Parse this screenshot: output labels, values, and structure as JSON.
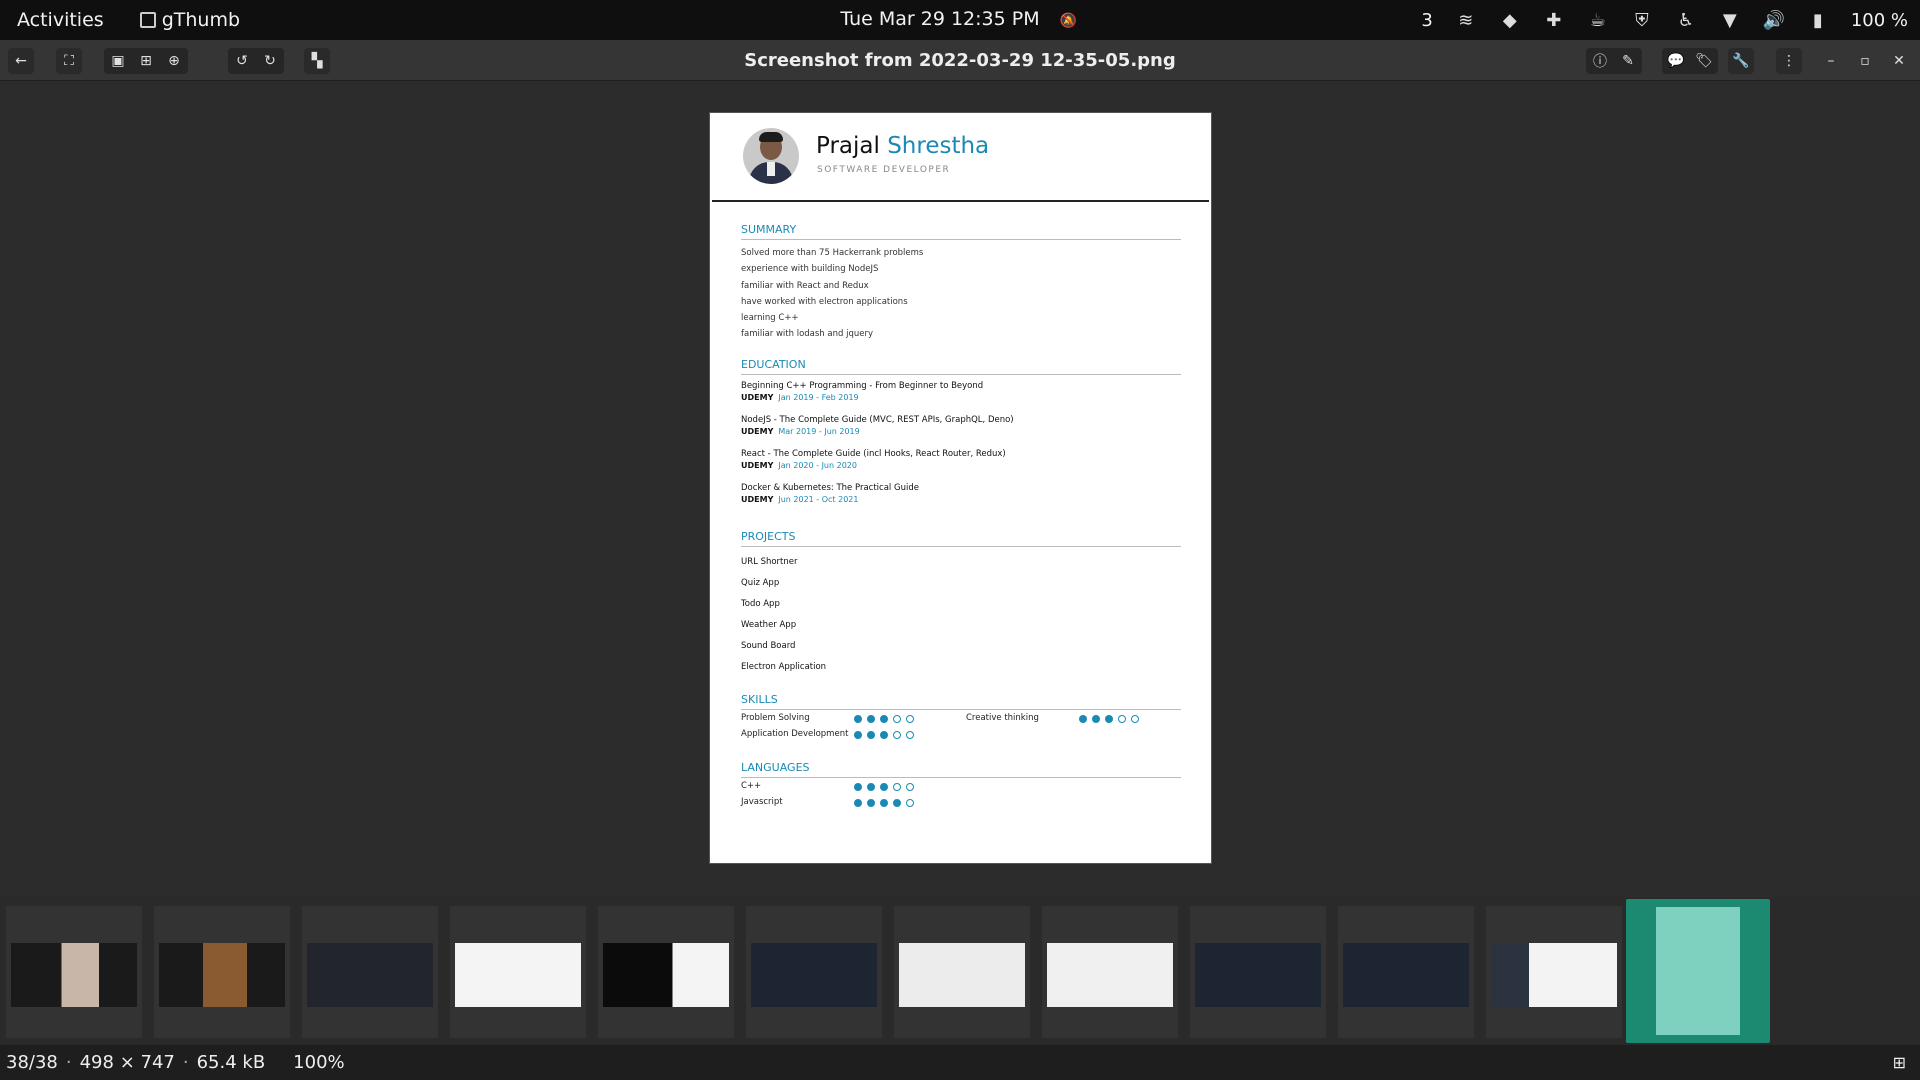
{
  "topbar": {
    "activities": "Activities",
    "app_name": "gThumb",
    "clock": "Tue Mar 29  12:35 PM",
    "workspace": "3",
    "battery": "100 %"
  },
  "header": {
    "title": "Screenshot from 2022-03-29 12-35-05.png"
  },
  "resume": {
    "first_name": "Prajal",
    "last_name": "Shrestha",
    "role": "SOFTWARE DEVELOPER",
    "summary_title": "SUMMARY",
    "summary": [
      "Solved more than 75 Hackerrank problems",
      "experience with building NodeJS",
      "familiar with React and Redux",
      "have worked with electron applications",
      "learning C++",
      "familiar with lodash and jquery"
    ],
    "education_title": "EDUCATION",
    "education": [
      {
        "course": "Beginning C++ Programming - From Beginner to Beyond",
        "school": "UDEMY",
        "dates": "Jan 2019 - Feb 2019"
      },
      {
        "course": "NodeJS - The Complete Guide (MVC, REST APIs, GraphQL, Deno)",
        "school": "UDEMY",
        "dates": "Mar 2019 - Jun 2019"
      },
      {
        "course": "React - The Complete Guide (incl Hooks, React Router, Redux)",
        "school": "UDEMY",
        "dates": "Jan 2020 - Jun 2020"
      },
      {
        "course": "Docker & Kubernetes: The Practical Guide",
        "school": "UDEMY",
        "dates": "Jun 2021 - Oct 2021"
      }
    ],
    "projects_title": "PROJECTS",
    "projects": [
      "URL Shortner",
      "Quiz App",
      "Todo App",
      "Weather App",
      "Sound Board",
      "Electron Application"
    ],
    "skills_title": "SKILLS",
    "skills": [
      {
        "name": "Problem Solving",
        "level": 3
      },
      {
        "name": "Creative thinking",
        "level": 3
      },
      {
        "name": "Application Development",
        "level": 3
      }
    ],
    "languages_title": "LANGUAGES",
    "languages": [
      {
        "name": "C++",
        "level": 3
      },
      {
        "name": "Javascript",
        "level": 4
      }
    ]
  },
  "status": {
    "position": "38/38",
    "dimensions": "498 × 747",
    "size": "65.4 kB",
    "zoom": "100%"
  }
}
